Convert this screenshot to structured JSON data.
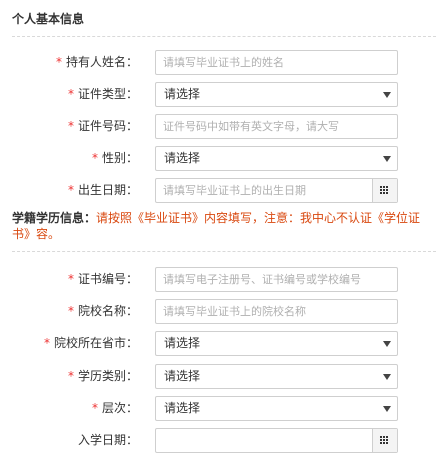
{
  "section1": {
    "title": "个人基本信息",
    "fields": [
      {
        "label": "持有人姓名：",
        "required": "*",
        "type": "input",
        "placeholder": "请填写毕业证书上的姓名"
      },
      {
        "label": "证件类型：",
        "required": "*",
        "type": "select",
        "value": "请选择"
      },
      {
        "label": "证件号码：",
        "required": "*",
        "type": "input",
        "placeholder": "证件号码中如带有英文字母，请大写"
      },
      {
        "label": "性别：",
        "required": "*",
        "type": "select",
        "value": "请选择"
      },
      {
        "label": "出生日期：",
        "required": "*",
        "type": "date",
        "placeholder": "请填写毕业证书上的出生日期"
      }
    ]
  },
  "notice": {
    "heading": "学籍学历信息：",
    "text": "请按照《毕业证书》内容填写，注意：我中心不认证《学位证书》容。"
  },
  "section2": {
    "fields": [
      {
        "label": "证书编号：",
        "required": "*",
        "type": "input",
        "placeholder": "请填写电子注册号、证书编号或学校编号"
      },
      {
        "label": "院校名称：",
        "required": "*",
        "type": "input",
        "placeholder": "请填写毕业证书上的院校名称"
      },
      {
        "label": "院校所在省市：",
        "required": "*",
        "type": "select",
        "value": "请选择"
      },
      {
        "label": "学历类别：",
        "required": "*",
        "type": "select",
        "value": "请选择"
      },
      {
        "label": "层次：",
        "required": "*",
        "type": "select",
        "value": "请选择"
      },
      {
        "label": "入学日期：",
        "required": "",
        "type": "date",
        "placeholder": ""
      }
    ]
  },
  "icons": {
    "select_arrow": "triangle-down-icon",
    "calendar": "calendar-grid-icon"
  }
}
